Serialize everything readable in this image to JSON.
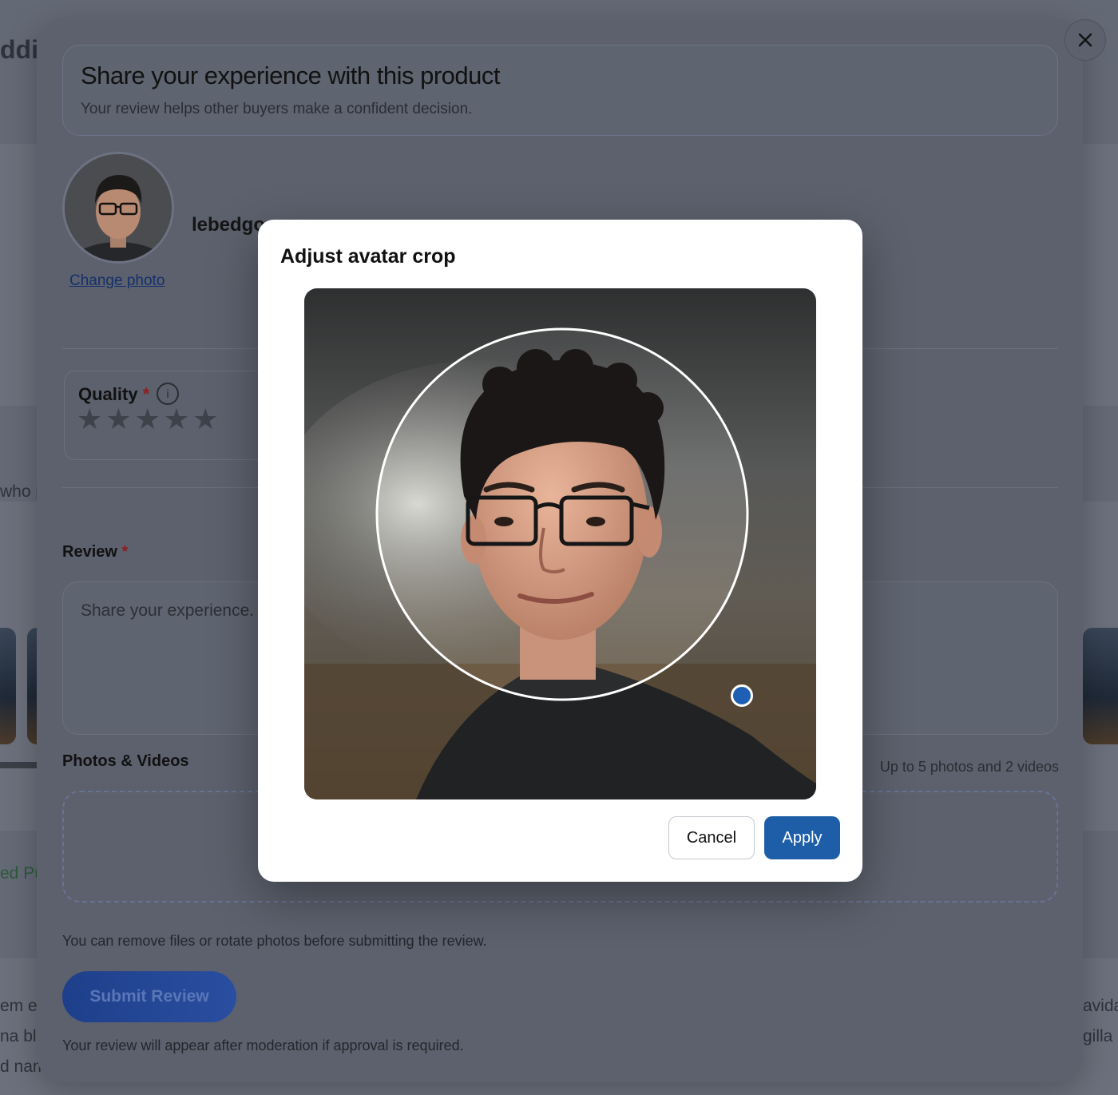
{
  "background": {
    "heading_fragment": "ddi",
    "left_text": [
      "who p",
      "ed Pu",
      "em e",
      "na bla",
      "d nam"
    ],
    "right_text": [
      "avida",
      "gilla r"
    ]
  },
  "review_modal": {
    "close_icon": "close-icon",
    "intro": {
      "title": "Share your experience with this product",
      "subtitle": "Your review helps other buyers make a confident decision."
    },
    "username": "lebedgo",
    "change_photo_label": "Change photo",
    "quality": {
      "label": "Quality",
      "required_mark": "*",
      "info_icon": "info-icon",
      "info_glyph": "i",
      "rating": 0,
      "max": 5
    },
    "review": {
      "label": "Review",
      "required_mark": "*",
      "placeholder": "Share your experience."
    },
    "media": {
      "label": "Photos & Videos",
      "hint": "Up to 5 photos and 2 videos"
    },
    "files_note": "You can remove files or rotate photos before submitting the review.",
    "submit_label": "Submit Review",
    "moderation_note": "Your review will appear after moderation if approval is required."
  },
  "crop_dialog": {
    "title": "Adjust avatar crop",
    "cancel_label": "Cancel",
    "apply_label": "Apply"
  },
  "colors": {
    "accent": "#1e5ea8",
    "required": "#8b1f1f",
    "overlay": "#5c616d"
  }
}
